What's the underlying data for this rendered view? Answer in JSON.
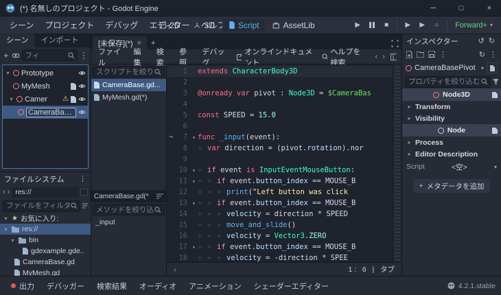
{
  "window": {
    "title": "(*) 名無しのプロジェクト - Godot Engine"
  },
  "menubar": {
    "items": [
      "シーン",
      "プロジェクト",
      "デバッグ",
      "エディター",
      "ヘルプ"
    ]
  },
  "workspace": {
    "tabs": [
      "2D",
      "3D",
      "Script",
      "AssetLib"
    ]
  },
  "toolbar": {
    "renderer": "Forward+"
  },
  "scene_dock": {
    "tabs": [
      "シーン",
      "インポート"
    ],
    "filter_placeholder": "フィ",
    "nodes": [
      {
        "name": "Prototype"
      },
      {
        "name": "MyMesh"
      },
      {
        "name": "Camer"
      },
      {
        "name": "CameraBase.."
      }
    ]
  },
  "filesystem_dock": {
    "title": "ファイルシステム",
    "breadcrumb": "res://",
    "filter_placeholder": "ファイルをフィルタ",
    "favorites_label": "お気に入り:",
    "items": [
      {
        "name": "res://"
      },
      {
        "name": "bin"
      },
      {
        "name": "gdexample.gde.."
      },
      {
        "name": "CameraBase.gd"
      },
      {
        "name": "MyMesh.gd"
      }
    ]
  },
  "scene_tabs": {
    "tab": "[未保存](*)"
  },
  "script_editor": {
    "menus": [
      "ファイル",
      "編集",
      "検索",
      "参照",
      "デバッグ"
    ],
    "online_docs": "オンラインドキュメント",
    "search_help": "ヘルプを検索",
    "script_filter_placeholder": "スクリプトを絞り",
    "scripts": [
      {
        "name": "CameraBase.gd..."
      },
      {
        "name": "MyMesh.gd(*)"
      }
    ],
    "current_script": "CameraBase.gd(*",
    "method_filter_placeholder": "メソッドを絞り込",
    "method": "_input",
    "status": "1 :   6   |   タブ"
  },
  "code_editor": {
    "lines": [
      {
        "n": "1",
        "cur": true,
        "tokens": [
          [
            "kw",
            "extends"
          ],
          [
            "pl",
            " "
          ],
          [
            "ty",
            "CharacterBody3D"
          ]
        ]
      },
      {
        "n": "2",
        "tokens": []
      },
      {
        "n": "3",
        "tokens": [
          [
            "kw",
            "@onready"
          ],
          [
            "pl",
            " "
          ],
          [
            "kw",
            "var"
          ],
          [
            "pl",
            " pivot : "
          ],
          [
            "ty",
            "Node3D"
          ],
          [
            "pl",
            " = "
          ],
          [
            "np",
            "$CameraBas"
          ]
        ]
      },
      {
        "n": "4",
        "tokens": []
      },
      {
        "n": "5",
        "tokens": [
          [
            "kw",
            "const"
          ],
          [
            "pl",
            " SPEED = "
          ],
          [
            "nu",
            "15.0"
          ]
        ]
      },
      {
        "n": "6",
        "tokens": []
      },
      {
        "n": "7",
        "fold": true,
        "mark": true,
        "tokens": [
          [
            "kw",
            "func"
          ],
          [
            "pl",
            " "
          ],
          [
            "fn",
            "_input"
          ],
          [
            "pl",
            "(event):"
          ]
        ]
      },
      {
        "n": "8",
        "tabs": 1,
        "tokens": [
          [
            "kw",
            "var"
          ],
          [
            "pl",
            " direction = (pivot."
          ],
          [
            "me",
            "rotation"
          ],
          [
            "pl",
            ").nor"
          ]
        ]
      },
      {
        "n": "9",
        "tokens": []
      },
      {
        "n": "10",
        "fold": true,
        "tabs": 1,
        "tokens": [
          [
            "cf",
            "if"
          ],
          [
            "pl",
            " event "
          ],
          [
            "kw",
            "is"
          ],
          [
            "pl",
            " "
          ],
          [
            "ty",
            "InputEventMouseButton"
          ],
          [
            "pl",
            ":"
          ]
        ]
      },
      {
        "n": "11",
        "fold": true,
        "tabs": 2,
        "tokens": [
          [
            "cf",
            "if"
          ],
          [
            "pl",
            " event."
          ],
          [
            "me",
            "button_index"
          ],
          [
            "pl",
            " == MOUSE_B"
          ]
        ]
      },
      {
        "n": "12",
        "tabs": 3,
        "tokens": [
          [
            "fn",
            "print"
          ],
          [
            "pl",
            "("
          ],
          [
            "st",
            "\"Left button was click"
          ]
        ]
      },
      {
        "n": "13",
        "fold": true,
        "tabs": 2,
        "tokens": [
          [
            "cf",
            "if"
          ],
          [
            "pl",
            " event."
          ],
          [
            "me",
            "button_index"
          ],
          [
            "pl",
            " == MOUSE_B"
          ]
        ]
      },
      {
        "n": "14",
        "tabs": 3,
        "tokens": [
          [
            "me",
            "velocity"
          ],
          [
            "pl",
            " = direction * SPEED"
          ]
        ]
      },
      {
        "n": "15",
        "tabs": 3,
        "tokens": [
          [
            "fn",
            "move_and_slide"
          ],
          [
            "pl",
            "()"
          ]
        ]
      },
      {
        "n": "16",
        "tabs": 3,
        "tokens": [
          [
            "me",
            "velocity"
          ],
          [
            "pl",
            " = "
          ],
          [
            "ty",
            "Vector3"
          ],
          [
            "pl",
            "."
          ],
          [
            "cs",
            "ZERO"
          ]
        ]
      },
      {
        "n": "17",
        "fold": true,
        "tabs": 2,
        "tokens": [
          [
            "cf",
            "if"
          ],
          [
            "pl",
            " event."
          ],
          [
            "me",
            "button_index"
          ],
          [
            "pl",
            " == MOUSE_B"
          ]
        ]
      },
      {
        "n": "18",
        "tabs": 3,
        "tokens": [
          [
            "me",
            "velocity"
          ],
          [
            "pl",
            " = -direction * SPEE"
          ]
        ]
      }
    ]
  },
  "inspector": {
    "title": "インスペクター",
    "node_name": "CameraBasePivot",
    "filter_placeholder": "プロパティを絞り込む",
    "category1": "Node3D",
    "category2": "Node",
    "rows": [
      "Transform",
      "Visibility",
      "Process",
      "Editor Description"
    ],
    "script_label": "Script",
    "script_value": "<空>",
    "add_metadata": "メタデータを追加"
  },
  "bottom_bar": {
    "items": [
      "出力",
      "デバッガー",
      "検索結果",
      "オーディオ",
      "アニメーション",
      "シェーダーエディター"
    ],
    "version": "4.2.1.stable"
  }
}
